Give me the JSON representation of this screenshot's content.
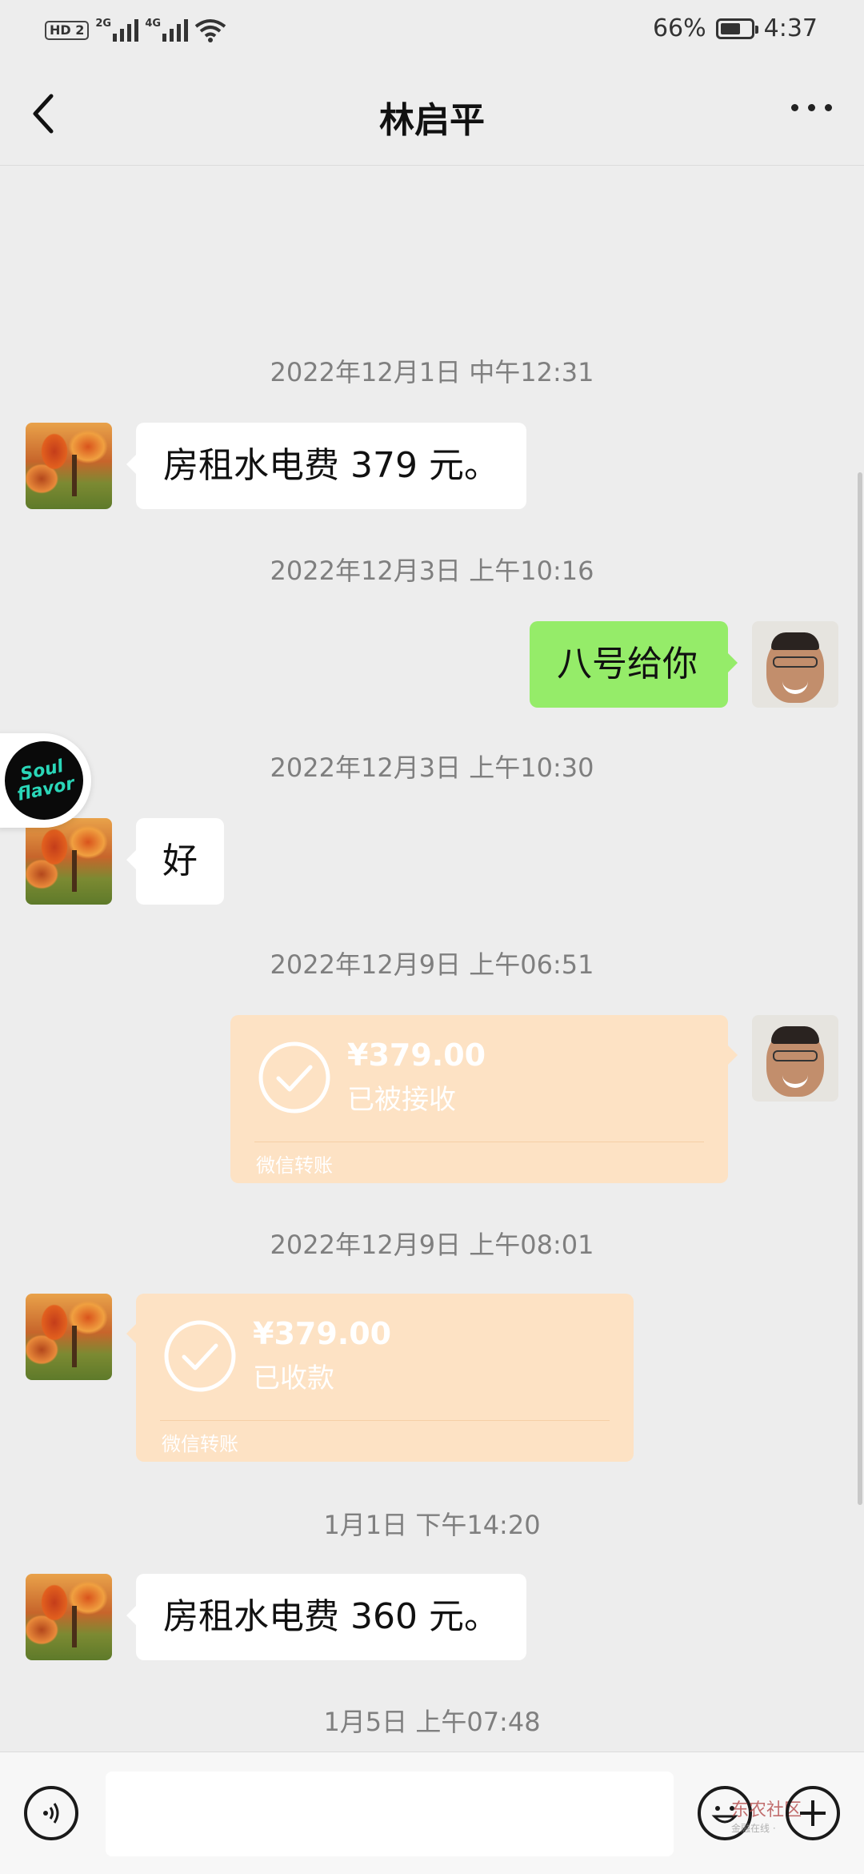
{
  "status_bar": {
    "hd_badge": "HD 2",
    "net1": "2G",
    "net2": "4G",
    "battery_text": "66%",
    "battery_level": 0.66,
    "time": "4:37"
  },
  "header": {
    "title": "林启平"
  },
  "messages": [
    {
      "type": "timestamp",
      "text": "2022年12月1日 中午12:31"
    },
    {
      "type": "text",
      "side": "in",
      "text": "房租水电费 379 元。"
    },
    {
      "type": "timestamp",
      "text": "2022年12月3日 上午10:16"
    },
    {
      "type": "text",
      "side": "out",
      "text": "八号给你"
    },
    {
      "type": "timestamp",
      "text": "2022年12月3日 上午10:30"
    },
    {
      "type": "text",
      "side": "in",
      "text": "好"
    },
    {
      "type": "timestamp",
      "text": "2022年12月9日 上午06:51"
    },
    {
      "type": "transfer",
      "side": "out",
      "amount": "¥379.00",
      "status": "已被接收",
      "footer": "微信转账"
    },
    {
      "type": "timestamp",
      "text": "2022年12月9日 上午08:01"
    },
    {
      "type": "transfer",
      "side": "in",
      "amount": "¥379.00",
      "status": "已收款",
      "footer": "微信转账"
    },
    {
      "type": "timestamp",
      "text": "1月1日 下午14:20"
    },
    {
      "type": "text",
      "side": "in",
      "text": "房租水电费 360 元。"
    },
    {
      "type": "timestamp",
      "text": "1月5日 上午07:48"
    }
  ],
  "floating_badge": {
    "line1": "Soul",
    "line2": "flavor"
  },
  "input_bar": {
    "value": "",
    "placeholder": "",
    "watermark_line1": "东农社区",
    "watermark_line2": "金融在线 ·"
  },
  "icons": {
    "back": "back-arrow-icon",
    "more": "more-dots-icon",
    "voice": "voice-icon",
    "emoji": "emoji-icon",
    "plus": "plus-icon",
    "transfer_check": "check-circle-icon"
  },
  "colors": {
    "background": "#ededed",
    "outgoing_bubble": "#95ec69",
    "incoming_bubble": "#ffffff",
    "transfer_bubble": "#fde2c4"
  }
}
